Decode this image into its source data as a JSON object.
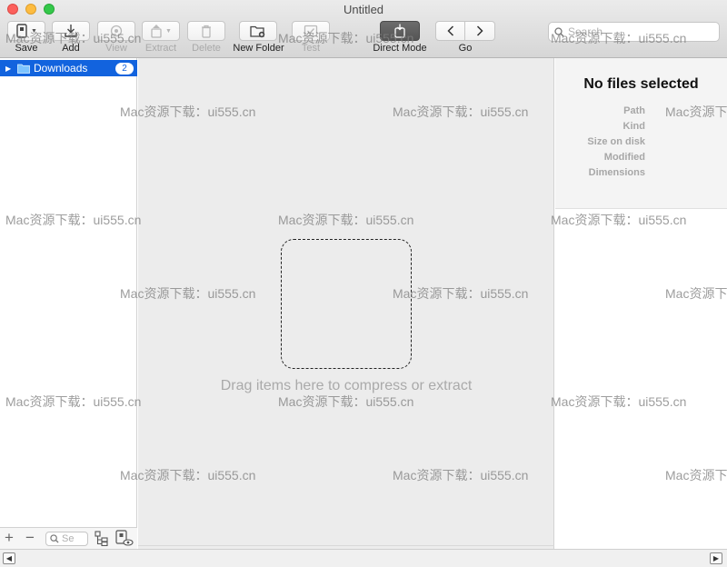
{
  "window": {
    "title": "Untitled"
  },
  "toolbar": {
    "save": "Save",
    "add": "Add",
    "view": "View",
    "extract": "Extract",
    "delete": "Delete",
    "new_folder": "New Folder",
    "test": "Test",
    "direct_mode": "Direct Mode",
    "go": "Go",
    "search_placeholder": "Search"
  },
  "sidebar": {
    "items": [
      {
        "label": "Downloads",
        "badge": "2",
        "icon": "folder-icon",
        "selected": true
      }
    ],
    "filter_placeholder": "Se",
    "add_symbol": "+",
    "remove_symbol": "−"
  },
  "main": {
    "drop_hint": "Drag items here to compress or extract"
  },
  "inspector": {
    "title": "No files selected",
    "fields": [
      "Path",
      "Kind",
      "Size on disk",
      "Modified",
      "Dimensions"
    ]
  },
  "watermark": {
    "text": "Mac资源下载：ui555.cn"
  },
  "colors": {
    "selection": "#1263de",
    "close": "#fc605c",
    "minimize": "#fdbc40",
    "maximize": "#34c84a"
  }
}
